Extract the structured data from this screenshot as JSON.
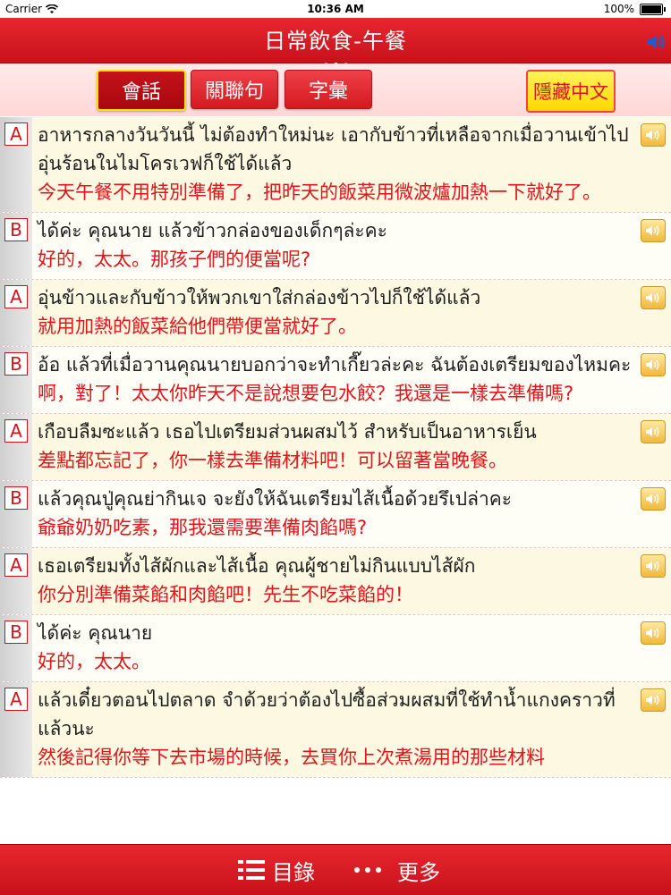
{
  "status": {
    "carrier": "Carrier",
    "time": "10:36 AM",
    "battery": "100%"
  },
  "header": {
    "title": "日常飲食-午餐"
  },
  "tabs": {
    "talk": "會話",
    "related": "關聯句",
    "vocab": "字彙",
    "hide_chinese": "隱藏中文"
  },
  "dialogue": [
    {
      "speaker": "A",
      "thai": "อาหารกลางวันวันนี้ ไม่ต้องทำใหม่นะ เอากับข้าวที่เหลือจากเมื่อวานเข้าไปอุ่นร้อนในไมโครเวฟก็ใช้ได้แล้ว",
      "zh": "今天午餐不用特別準備了，把昨天的飯菜用微波爐加熱一下就好了。"
    },
    {
      "speaker": "B",
      "thai": "ได้ค่ะ คุณนาย แล้วข้าวกล่องของเด็กๆล่ะคะ",
      "zh": "好的，太太。那孩子們的便當呢?"
    },
    {
      "speaker": "A",
      "thai": "อุ่นข้าวและกับข้าวให้พวกเขาใส่กล่องข้าวไปก็ใช้ได้แล้ว",
      "zh": "就用加熱的飯菜給他們帶便當就好了。"
    },
    {
      "speaker": "B",
      "thai": "อ้อ แล้วที่เมื่อวานคุณนายบอกว่าจะทำเกี๊ยวล่ะคะ ฉันต้องเตรียมของไหมคะ",
      "zh": "啊，對了！太太你昨天不是說想要包水餃？我還是一樣去準備嗎?"
    },
    {
      "speaker": "A",
      "thai": "เกือบลืมซะแล้ว เธอไปเตรียมส่วนผสมไว้ สำหรับเป็นอาหารเย็น",
      "zh": "差點都忘記了，你一樣去準備材料吧！可以留著當晚餐。"
    },
    {
      "speaker": "B",
      "thai": "แล้วคุณปู่คุณย่ากินเจ จะยังให้ฉันเตรียมไส้เนื้อด้วยรึเปล่าคะ",
      "zh": "爺爺奶奶吃素，那我還需要準備肉餡嗎?"
    },
    {
      "speaker": "A",
      "thai": "เธอเตรียมทั้งไส้ผักและไส้เนื้อ คุณผู้ชายไม่กินแบบไส้ผัก",
      "zh": "你分別準備菜餡和肉餡吧！先生不吃菜餡的！"
    },
    {
      "speaker": "B",
      "thai": "ได้ค่ะ คุณนาย",
      "zh": "好的，太太。"
    },
    {
      "speaker": "A",
      "thai": "แล้วเดี๋ยวตอนไปตลาด จำด้วยว่าต้องไปซื้อส่วมผสมที่ใช้ทำน้ำแกงคราวที่แล้วนะ",
      "zh": "然後記得你等下去市場的時候，去買你上次煮湯用的那些材料"
    }
  ],
  "bottom": {
    "toc": "目錄",
    "more": "更多"
  },
  "colors": {
    "primary_red": "#d41920",
    "chinese_text": "#e0141b",
    "highlight_yellow": "#ffd800"
  }
}
